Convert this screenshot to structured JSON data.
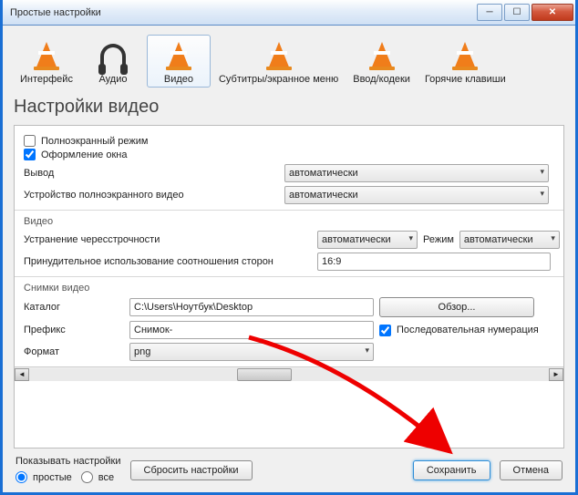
{
  "window": {
    "title": "Простые настройки"
  },
  "tabs": [
    {
      "label": "Интерфейс"
    },
    {
      "label": "Аудио"
    },
    {
      "label": "Видео"
    },
    {
      "label": "Субтитры/экранное меню"
    },
    {
      "label": "Ввод/кодеки"
    },
    {
      "label": "Горячие клавиши"
    }
  ],
  "heading": "Настройки видео",
  "fullscreen_label": "Полноэкранный режим",
  "decor_label": "Оформление окна",
  "output_label": "Вывод",
  "output_value": "автоматически",
  "fsdev_label": "Устройство полноэкранного видео",
  "fsdev_value": "автоматически",
  "video_group": "Видео",
  "deint_label": "Устранение чересстрочности",
  "deint_value": "автоматически",
  "mode_label": "Режим",
  "mode_value": "автоматически",
  "aspect_label": "Принудительное использование соотношения сторон",
  "aspect_value": "16:9",
  "snap_group": "Снимки видео",
  "dir_label": "Каталог",
  "dir_value": "C:\\Users\\Ноутбук\\Desktop",
  "browse": "Обзор...",
  "prefix_label": "Префикс",
  "prefix_value": "Снимок-",
  "seq_label": "Последовательная нумерация",
  "format_label": "Формат",
  "format_value": "png",
  "footer": {
    "show_label": "Показывать настройки",
    "simple": "простые",
    "all": "все",
    "reset": "Сбросить настройки",
    "save": "Сохранить",
    "cancel": "Отмена"
  }
}
